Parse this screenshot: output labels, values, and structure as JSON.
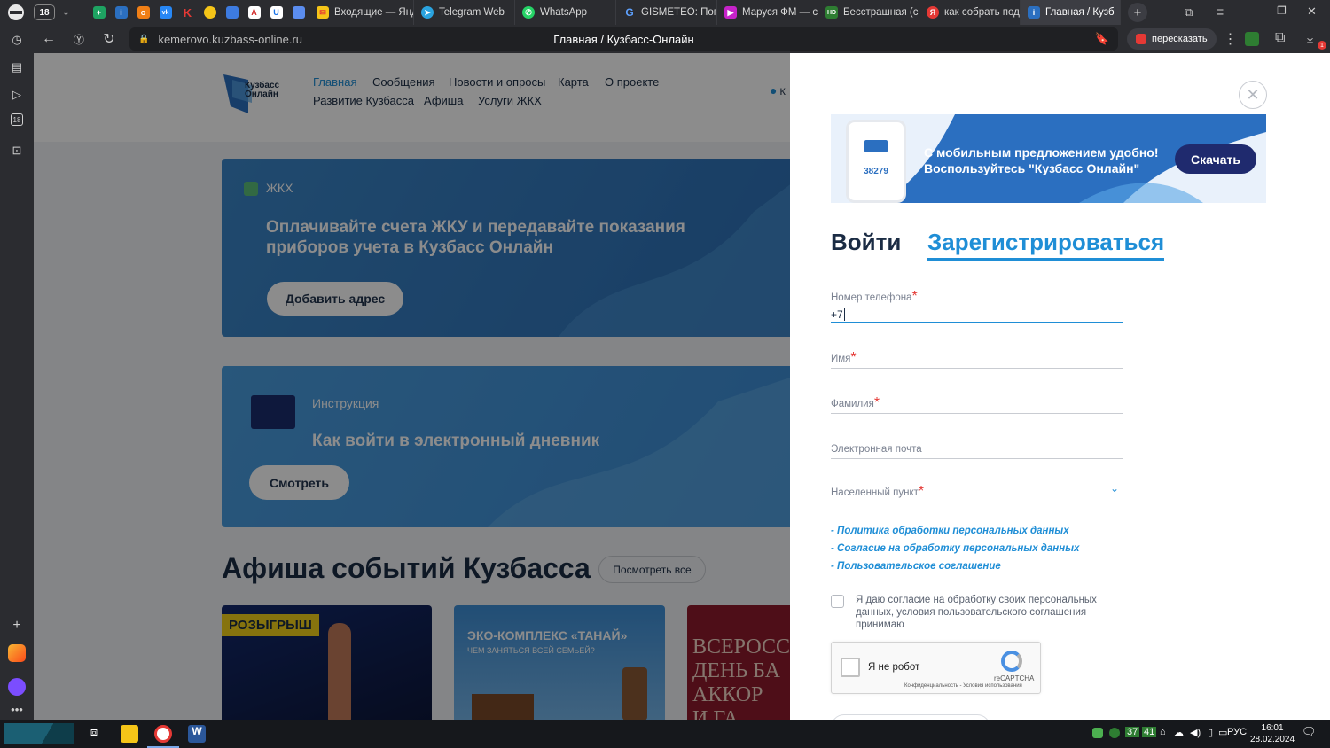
{
  "browser": {
    "tab_count_badge": "18",
    "tabs": [
      {
        "label": "Входящие — Янд"
      },
      {
        "label": "Telegram Web"
      },
      {
        "label": "WhatsApp"
      },
      {
        "label": "GISMETEO: Погод"
      },
      {
        "label": "Маруся ФМ — са"
      },
      {
        "label": "Бесстрашная (се"
      },
      {
        "label": "как собрать под"
      },
      {
        "label": "Главная / Кузб"
      }
    ],
    "url": "kemerovo.kuzbass-online.ru",
    "page_title": "Главная / Кузбасс-Онлайн",
    "retell_label": "пересказать",
    "notification_badge": "1"
  },
  "site": {
    "logo_lines": [
      "Кузбасс",
      "Онлайн"
    ],
    "nav_row1": [
      "Главная",
      "Сообщения",
      "Новости и опросы",
      "Карта",
      "О проекте"
    ],
    "nav_row2": [
      "Развитие Кузбасса",
      "Афиша",
      "Услуги ЖКХ"
    ],
    "location_letter": "К",
    "zhkh_card": {
      "tag": "ЖКХ",
      "title_line1": "Оплачивайте счета ЖКУ и передавайте показания",
      "title_line2": "приборов учета в Кузбасс Онлайн",
      "button": "Добавить адрес"
    },
    "instruction_card": {
      "tag": "Инструкция",
      "title": "Как войти в электронный дневник",
      "button": "Смотреть"
    },
    "events": {
      "heading": "Афиша событий Кузбасса",
      "see_all": "Посмотреть все",
      "card1_badge": "РОЗЫГРЫШ",
      "card2_title": "ЭКО-КОМПЛЕКС «ТАНАЙ»",
      "card2_subtitle": "ЧЕМ ЗАНЯТЬСЯ ВСЕЙ СЕМЬЕЙ?",
      "card3_lines": [
        "ВСЕРОСС",
        "ДЕНЬ БА",
        "АККОР",
        "И ГА"
      ]
    }
  },
  "modal": {
    "banner": {
      "line1": "С мобильным предложением удобно!",
      "line2": "Воспользуйтесь \"Кузбасс Онлайн\"",
      "phone_number": "38279",
      "download": "Скачать"
    },
    "tab_login": "Войти",
    "tab_register": "Зарегистрироваться",
    "fields": {
      "phone_label": "Номер телефона",
      "phone_value": "+7",
      "name_label": "Имя",
      "surname_label": "Фамилия",
      "email_label": "Электронная почта",
      "city_label": "Населенный пункт"
    },
    "required_mark": "*",
    "links": [
      "Политика обработки персональных данных",
      "Согласие на обработку персональных данных",
      "Пользовательское соглашение"
    ],
    "link_dash": "-",
    "consent_lines": [
      "Я даю согласие на обработку своих персональных",
      "данных, условия пользовательского соглашения",
      "принимаю"
    ],
    "recaptcha": {
      "label": "Я не робот",
      "brand": "reCAPTCHA",
      "footer": "Конфиденциальность - Условия использования"
    }
  },
  "taskbar": {
    "tray_num1": "37",
    "tray_num2": "41",
    "lang": "РУС",
    "time": "16:01",
    "date": "28.02.2024"
  },
  "colors": {
    "accent": "#1f8ed6",
    "dark_navy": "#1f2a6e",
    "required": "#e53935"
  }
}
